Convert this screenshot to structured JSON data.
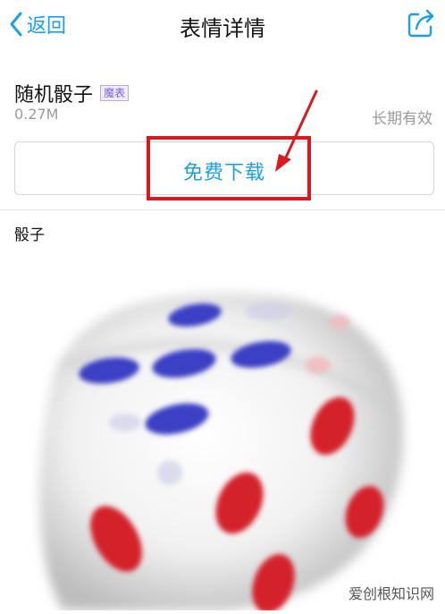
{
  "nav": {
    "back_label": "返回",
    "title": "表情详情",
    "back_icon": "chevron-left-icon",
    "share_icon": "share-icon"
  },
  "package": {
    "name": "随机骰子",
    "badge": "魔表",
    "size": "0.27M",
    "validity": "长期有效"
  },
  "download": {
    "label": "免费下载"
  },
  "section": {
    "title": "骰子"
  },
  "preview": {
    "image": "dice-image"
  },
  "watermark": {
    "text": "爱创根知识网"
  },
  "colors": {
    "accent": "#1a9ee6",
    "annotation": "#d9191f",
    "badge": "#7b5fe0"
  }
}
